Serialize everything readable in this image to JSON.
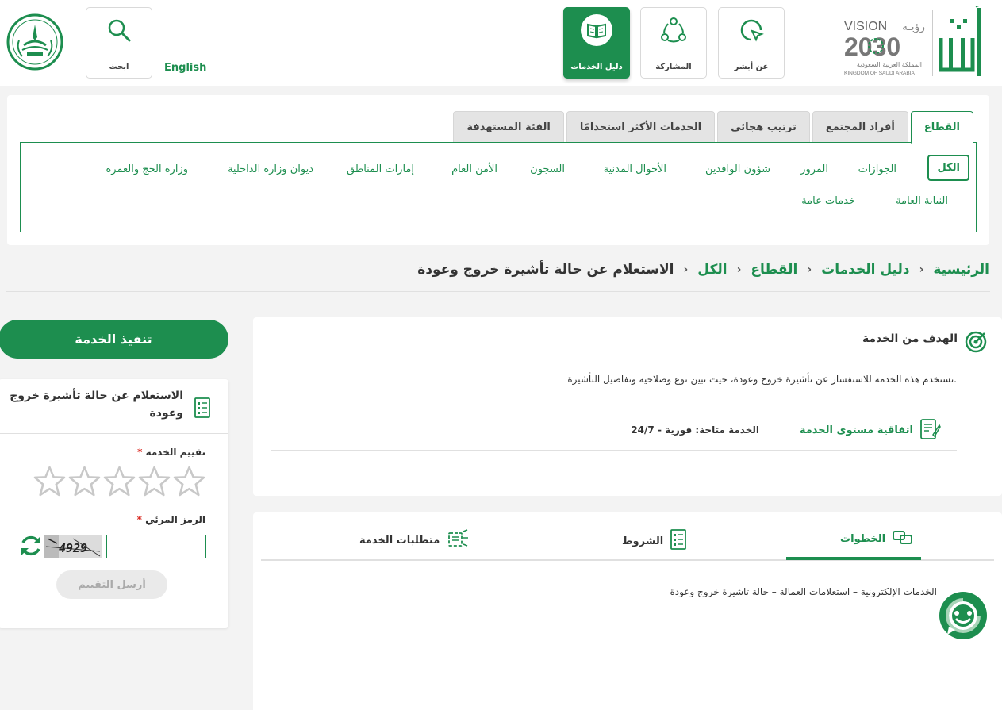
{
  "header": {
    "tiles": {
      "about": "عن أبشر",
      "participation": "المشاركة",
      "services_guide": "دليل الخدمات",
      "search": "ابحث"
    },
    "english_link": "English",
    "vision_logo": {
      "word": "VISION",
      "arabic_word": "رؤيـة",
      "year": "2030",
      "kingdom_ar": "المملكة العربية السعودية",
      "kingdom_en": "KINGDOM OF SAUDI ARABIA"
    },
    "brand_color": "#1d8e4f"
  },
  "category_panel": {
    "tabs": [
      "القطاع",
      "أفراد المجتمع",
      "ترتيب هجائي",
      "الخدمات الأكثر استخدامًا",
      "الفئة المستهدفة"
    ],
    "active_tab": "القطاع",
    "categories_row1": [
      "الكل",
      "الجوازات",
      "المرور",
      "شؤون الوافدين",
      "الأحوال المدنية",
      "السجون",
      "الأمن العام",
      "إمارات المناطق",
      "ديوان وزارة الداخلية",
      "وزارة الحج والعمرة"
    ],
    "categories_row2": [
      "النيابة العامة",
      "خدمات عامة"
    ],
    "active_category": "الكل"
  },
  "breadcrumb": {
    "home": "الرئيسية",
    "services_guide": "دليل الخدمات",
    "sector": "القطاع",
    "all": "الكل",
    "current": "الاستعلام عن حالة تأشيرة خروج وعودة",
    "separator": "›"
  },
  "goal": {
    "title": "الهدف من الخدمة",
    "description": "تستخدم هذه الخدمة للاستفسار عن تأشيرة خروج وعودة، حيث تبين نوع وصلاحية وتفاصيل التأشيرة.",
    "sla_label": "اتفاقية مستوى الخدمة",
    "availability": "الخدمة متاحة: فورية - 24/7"
  },
  "steps": {
    "tabs": {
      "steps": "الخطوات",
      "conditions": "الشروط",
      "requirements": "متطلبات الخدمة"
    },
    "active_tab": "الخطوات",
    "text": "الخدمات الإلكترونية – استعلامات العمالة – حالة تاشيرة خروج وعودة"
  },
  "execute_button": "تنفيذ الخدمة",
  "rating_card": {
    "title": "الاستعلام عن حالة تأشيرة خروج وعودة",
    "rating_label": "تقييم الخدمة",
    "required_mark": "*",
    "stars_max": 5,
    "stars_value": 0,
    "captcha_label": "الرمز المرئي",
    "captcha_value": "",
    "captcha_text": "4929",
    "send_button": "أرسل التقييم"
  }
}
